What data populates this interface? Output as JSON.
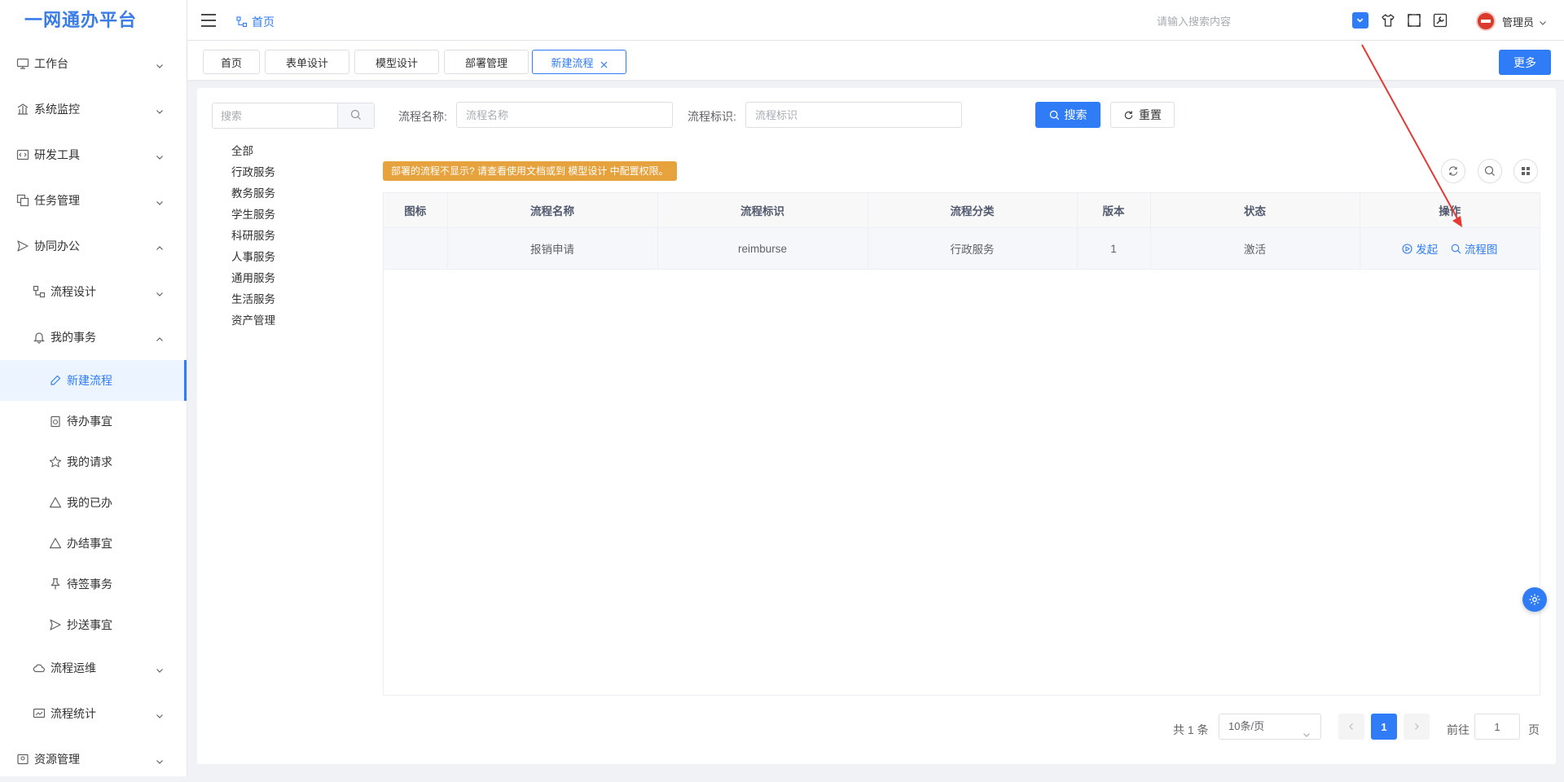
{
  "app_title": "一网通办平台",
  "header": {
    "breadcrumb": "首页",
    "search_placeholder": "请输入搜索内容",
    "user_name": "管理员"
  },
  "sidebar": {
    "items": [
      {
        "label": "工作台",
        "icon": "monitor-icon",
        "expanded": false
      },
      {
        "label": "系统监控",
        "icon": "monitor-chart-icon",
        "expanded": false
      },
      {
        "label": "研发工具",
        "icon": "code-icon",
        "expanded": false
      },
      {
        "label": "任务管理",
        "icon": "copy-icon",
        "expanded": false
      },
      {
        "label": "协同办公",
        "icon": "send-icon",
        "expanded": true
      }
    ],
    "sub_items": [
      {
        "label": "流程设计",
        "icon": "flow-icon",
        "expanded": false
      },
      {
        "label": "我的事务",
        "icon": "bell-icon",
        "expanded": true
      }
    ],
    "leaf_items": [
      {
        "label": "新建流程",
        "icon": "pen-icon",
        "active": true
      },
      {
        "label": "待办事宜",
        "icon": "clipboard-icon"
      },
      {
        "label": "我的请求",
        "icon": "star-icon"
      },
      {
        "label": "我的已办",
        "icon": "triangle-icon"
      },
      {
        "label": "办结事宜",
        "icon": "triangle-icon"
      },
      {
        "label": "待签事务",
        "icon": "pin-icon"
      },
      {
        "label": "抄送事宜",
        "icon": "send-icon"
      }
    ],
    "bottom_sub_items": [
      {
        "label": "流程运维",
        "icon": "cloud-icon"
      },
      {
        "label": "流程统计",
        "icon": "chart-icon"
      }
    ],
    "bottom_items": [
      {
        "label": "资源管理",
        "icon": "folder-icon"
      }
    ]
  },
  "tabs": [
    {
      "label": "首页"
    },
    {
      "label": "表单设计"
    },
    {
      "label": "模型设计"
    },
    {
      "label": "部署管理"
    },
    {
      "label": "新建流程",
      "active": true
    }
  ],
  "more_label": "更多",
  "tree": {
    "search_placeholder": "搜索",
    "items": [
      "全部",
      "行政服务",
      "教务服务",
      "学生服务",
      "科研服务",
      "人事服务",
      "通用服务",
      "生活服务",
      "资产管理"
    ]
  },
  "filters": {
    "name_label": "流程名称:",
    "name_placeholder": "流程名称",
    "key_label": "流程标识:",
    "key_placeholder": "流程标识",
    "search_label": "搜索",
    "reset_label": "重置"
  },
  "warning": "部署的流程不显示? 请查看使用文档或到 模型设计 中配置权限。",
  "table": {
    "columns": [
      "图标",
      "流程名称",
      "流程标识",
      "流程分类",
      "版本",
      "状态",
      "操作"
    ],
    "rows": [
      {
        "icon": "",
        "name": "报销申请",
        "key": "reimburse",
        "category": "行政服务",
        "version": "1",
        "status": "激活",
        "actions": [
          "发起",
          "流程图"
        ]
      }
    ]
  },
  "pagination": {
    "total": "共 1 条",
    "page_size": "10条/页",
    "current": "1",
    "goto_label": "前往",
    "goto_value": "1",
    "page_label": "页"
  },
  "colors": {
    "primary": "#2f7cf6",
    "warning": "#e6a23c",
    "annotation": "#e53935"
  }
}
